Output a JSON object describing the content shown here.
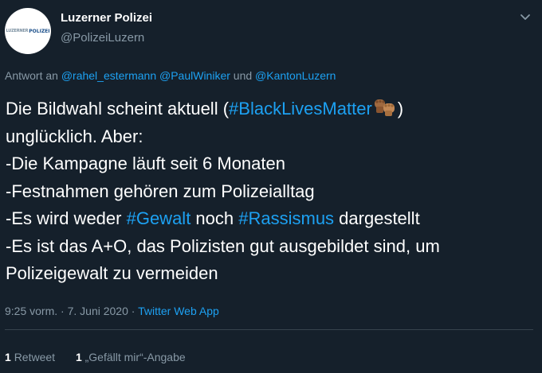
{
  "author": {
    "display_name": "Luzerner Polizei",
    "handle": "@PolizeiLuzern",
    "avatar_logo_left": "LUZERNER",
    "avatar_logo_right": "POLIZEI"
  },
  "reply": {
    "prefix": "Antwort an",
    "mention_1": "@rahel_estermann",
    "mention_2": "@PaulWiniker",
    "conjunction": "und",
    "mention_3": "@KantonLuzern"
  },
  "tweet": {
    "line1_pre": "Die Bildwahl scheint aktuell (",
    "hashtag_blm": "#BlackLivesMatter",
    "line1_post": ")",
    "line2": "unglücklich. Aber:",
    "line3": "-Die Kampagne läuft seit 6 Monaten",
    "line4": "-Festnahmen gehören zum Polizeialltag",
    "line5_pre": "-Es wird weder ",
    "hashtag_gewalt": "#Gewalt",
    "line5_mid": " noch ",
    "hashtag_rassismus": "#Rassismus",
    "line5_post": " dargestellt",
    "line6": "-Es ist das A+O, das Polizisten gut ausgebildet sind, um",
    "line7": "Polizeigewalt zu vermeiden",
    "emoji": "raised-fists-emoji"
  },
  "meta": {
    "time": "9:25 vorm.",
    "separator": "·",
    "date": "7. Juni 2020",
    "source": "Twitter Web App"
  },
  "stats": {
    "retweet_count": "1",
    "retweet_label": "Retweet",
    "like_count": "1",
    "like_label": "„Gefällt mir“-Angabe"
  },
  "colors": {
    "background": "#15202b",
    "link": "#1da1f2",
    "secondary_text": "#8899a6",
    "divider": "#38444d"
  }
}
